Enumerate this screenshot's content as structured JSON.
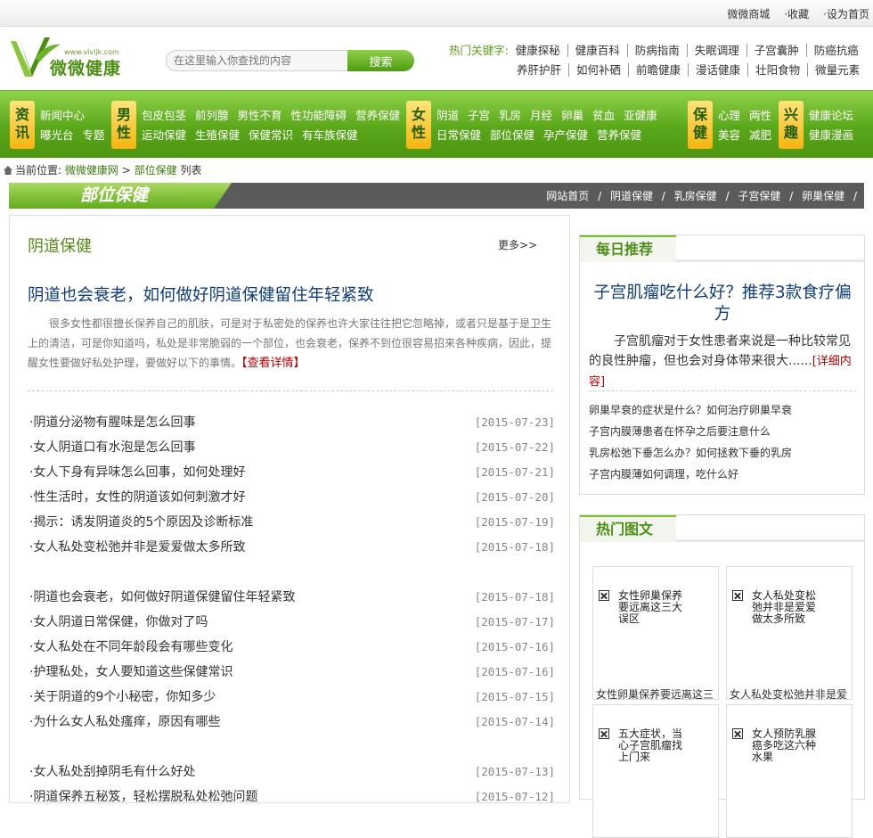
{
  "topbar": {
    "links": [
      "微微商城",
      "·收藏",
      "·设为首页"
    ]
  },
  "logo": {
    "url": "www.vlvljk.com",
    "name": "微微健康"
  },
  "search": {
    "placeholder": "在这里输入你查找的内容",
    "button": "搜索"
  },
  "hot": {
    "label": "热门关键字:",
    "row1": [
      "健康探秘",
      "健康百科",
      "防病指南",
      "失眠调理",
      "子宫囊肿",
      "防癌抗癌"
    ],
    "row2": [
      "养肝护肝",
      "如何补硒",
      "前瞻健康",
      "漫话健康",
      "壮阳食物",
      "微量元素"
    ]
  },
  "nav": [
    {
      "tag1": "资",
      "tag2": "讯",
      "row1": [
        "新闻中心"
      ],
      "row2": [
        "曝光台",
        "专题"
      ]
    },
    {
      "tag1": "男",
      "tag2": "性",
      "row1": [
        "包皮包茎",
        "前列腺",
        "男性不育",
        "性功能障碍",
        "营养保健"
      ],
      "row2": [
        "运动保健",
        "生殖保健",
        "保健常识",
        "有车族保健"
      ]
    },
    {
      "tag1": "女",
      "tag2": "性",
      "row1": [
        "阴道",
        "子宫",
        "乳房",
        "月经",
        "卵巢",
        "贫血",
        "亚健康"
      ],
      "row2": [
        "日常保健",
        "部位保健",
        "孕产保健",
        "营养保健"
      ]
    },
    {
      "tag1": "保",
      "tag2": "健",
      "row1": [
        "心理",
        "两性"
      ],
      "row2": [
        "美容",
        "减肥"
      ]
    },
    {
      "tag1": "兴",
      "tag2": "趣",
      "row1": [
        "健康论坛"
      ],
      "row2": [
        "健康漫画"
      ]
    }
  ],
  "breadcrumb": {
    "prefix": "当前位置:",
    "site": "微微健康网",
    "sep": ">",
    "cat": "部位保健",
    "tail": "列表"
  },
  "catbar": {
    "title": "部位保健",
    "links": [
      "网站首页",
      "/",
      "阴道保健",
      "/",
      "乳房保健",
      "/",
      "子宫保健",
      "/",
      "卵巢保健",
      "/"
    ]
  },
  "main": {
    "section": "阴道保健",
    "more": "更多>>",
    "headline": "阴道也会衰老，如何做好阴道保健留住年轻紧致",
    "summary": "很多女性都很擅长保养自己的肌肤，可是对于私密处的保养也许大家往往把它忽略掉，或者只是基于是卫生上的清洁，可是你知道吗，私处是非常脆弱的一个部位，也会衰老，保养不到位很容易招来各种疾病，因此，提醒女性要做好私处护理，要做好以下的事情。",
    "detail": "【查看详情】",
    "group1": [
      {
        "t": "·阴道分泌物有腥味是怎么回事",
        "d": "[2015-07-23]"
      },
      {
        "t": "·女人阴道口有水泡是怎么回事",
        "d": "[2015-07-22]"
      },
      {
        "t": "·女人下身有异味怎么回事，如何处理好",
        "d": "[2015-07-21]"
      },
      {
        "t": "·性生活时，女性的阴道该如何刺激才好",
        "d": "[2015-07-20]"
      },
      {
        "t": "·揭示：诱发阴道炎的5个原因及诊断标准",
        "d": "[2015-07-19]"
      },
      {
        "t": "·女人私处变松弛并非是爱爱做太多所致",
        "d": "[2015-07-18]"
      }
    ],
    "group2": [
      {
        "t": "·阴道也会衰老，如何做好阴道保健留住年轻紧致",
        "d": "[2015-07-18]"
      },
      {
        "t": "·女人阴道日常保健，你做对了吗",
        "d": "[2015-07-17]"
      },
      {
        "t": "·女人私处在不同年龄段会有哪些变化",
        "d": "[2015-07-16]"
      },
      {
        "t": "·护理私处，女人要知道这些保健常识",
        "d": "[2015-07-16]"
      },
      {
        "t": "·关于阴道的9个小秘密，你知多少",
        "d": "[2015-07-15]"
      },
      {
        "t": "·为什么女人私处瘙痒，原因有哪些",
        "d": "[2015-07-14]"
      }
    ],
    "group3": [
      {
        "t": "·女人私处刮掉阴毛有什么好处",
        "d": "[2015-07-13]"
      },
      {
        "t": "·阴道保养五秘笈，轻松摆脱私处松弛问题",
        "d": "[2015-07-12]"
      }
    ]
  },
  "daily": {
    "title": "每日推荐",
    "headline": "子宫肌瘤吃什么好？推荐3款食疗偏方",
    "text": "子宫肌瘤对于女性患者来说是一种比较常见的良性肿瘤，但也会对身体带来很大......",
    "detail": "[详细内容]",
    "list": [
      "卵巢早衰的症状是什么？如何治疗卵巢早衰",
      "子宫内膜薄患者在怀孕之后要注意什么",
      "乳房松弛下垂怎么办？如何拯救下垂的乳房",
      "子宫内膜薄如何调理，吃什么好"
    ]
  },
  "hotpics": {
    "title": "热门图文",
    "items": [
      {
        "alt": "女性卵巢保养要远离这三大误区",
        "cap": "女性卵巢保养要远离这三"
      },
      {
        "alt": "女人私处变松弛并非是爱爱做太多所致",
        "cap": "女人私处变松弛并非是爱"
      },
      {
        "alt": "五大症状，当心子宫肌瘤找上门来",
        "cap": ""
      },
      {
        "alt": "女人预防乳腺癌多吃这六种水果",
        "cap": ""
      }
    ]
  }
}
